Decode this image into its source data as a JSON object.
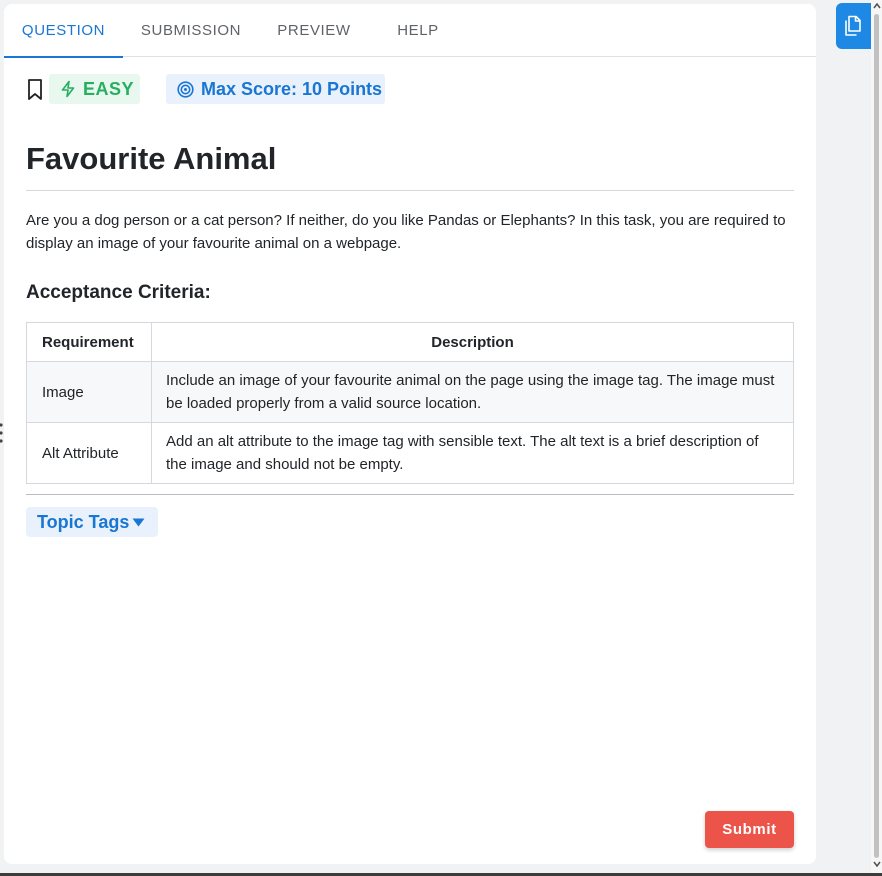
{
  "tabs": [
    {
      "label": "QUESTION",
      "active": true
    },
    {
      "label": "SUBMISSION",
      "active": false
    },
    {
      "label": "PREVIEW",
      "active": false
    },
    {
      "label": "HELP",
      "active": false
    }
  ],
  "badges": {
    "difficulty": "EASY",
    "max_score": "Max Score: 10 Points"
  },
  "problem": {
    "title": "Favourite Animal",
    "description": "Are you a dog person or a cat person? If neither, do you like Pandas or Elephants? In this task, you are required to display an image of your favourite animal on a webpage.",
    "criteria_heading": "Acceptance Criteria:"
  },
  "criteria_table": {
    "headers": [
      "Requirement",
      "Description"
    ],
    "rows": [
      {
        "requirement": "Image",
        "description": "Include an image of your favourite animal on the page using the image tag. The image must be loaded properly from a valid source location."
      },
      {
        "requirement": "Alt Attribute",
        "description": "Add an alt attribute to the image tag with sensible text. The alt text is a brief description of the image and should not be empty."
      }
    ]
  },
  "topic_tags": {
    "label": "Topic Tags"
  },
  "actions": {
    "submit_label": "Submit"
  },
  "icons": {
    "bookmark": "bookmark-icon",
    "difficulty": "lightning-icon",
    "score": "target-icon",
    "topic_caret": "caret-down-icon",
    "side": "file-copy-icon"
  },
  "colors": {
    "accent": "#1976d2",
    "easy": "#27ae60",
    "submit": "#ec5349",
    "side_button": "#1e88e5"
  }
}
